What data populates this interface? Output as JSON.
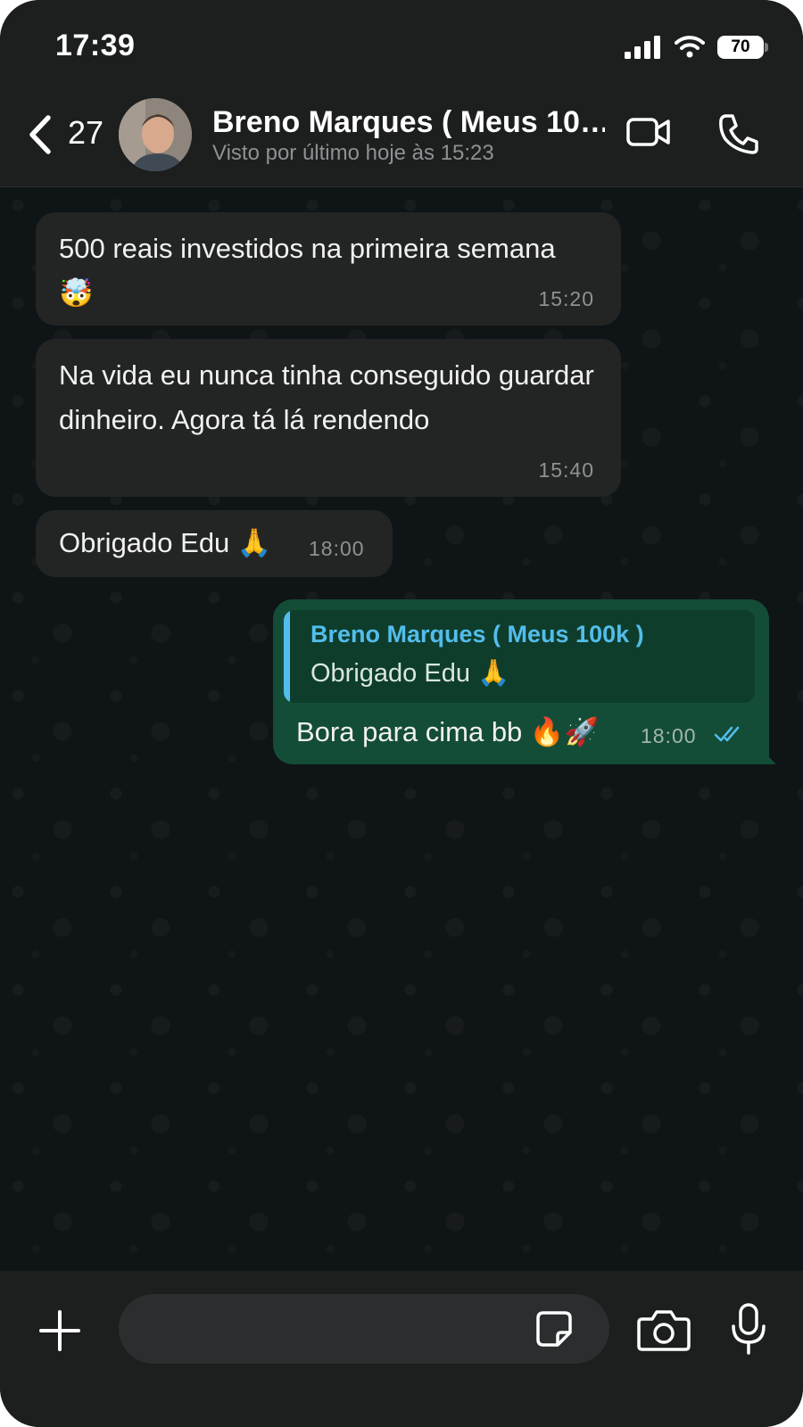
{
  "status_bar": {
    "time": "17:39",
    "battery": "70"
  },
  "header": {
    "back_count": "27",
    "contact_name": "Breno Marques ( Meus 10…",
    "last_seen": "Visto por último hoje às 15:23"
  },
  "messages": [
    {
      "direction": "in",
      "text": "500 reais investidos na primeira semana 🤯",
      "time": "15:20"
    },
    {
      "direction": "in",
      "text": "Na vida eu nunca tinha conseguido guardar dinheiro. Agora tá lá rendendo",
      "time": "15:40"
    },
    {
      "direction": "in",
      "text": "Obrigado Edu 🙏",
      "time": "18:00"
    },
    {
      "direction": "out",
      "quote_author": "Breno Marques ( Meus 100k )",
      "quote_text": "Obrigado Edu 🙏",
      "text": "Bora para cima bb 🔥🚀",
      "time": "18:00",
      "status": "read"
    }
  ],
  "icons": {
    "back": "chevron-left-icon",
    "video": "video-call-icon",
    "call": "phone-icon",
    "plus": "plus-icon",
    "sticker": "sticker-icon",
    "camera": "camera-icon",
    "mic": "microphone-icon",
    "read_ticks": "double-check-icon"
  },
  "colors": {
    "incoming_bubble": "#232525",
    "outgoing_bubble": "#144d37",
    "quote_accent": "#53bdeb",
    "read_tick": "#53bdeb"
  }
}
